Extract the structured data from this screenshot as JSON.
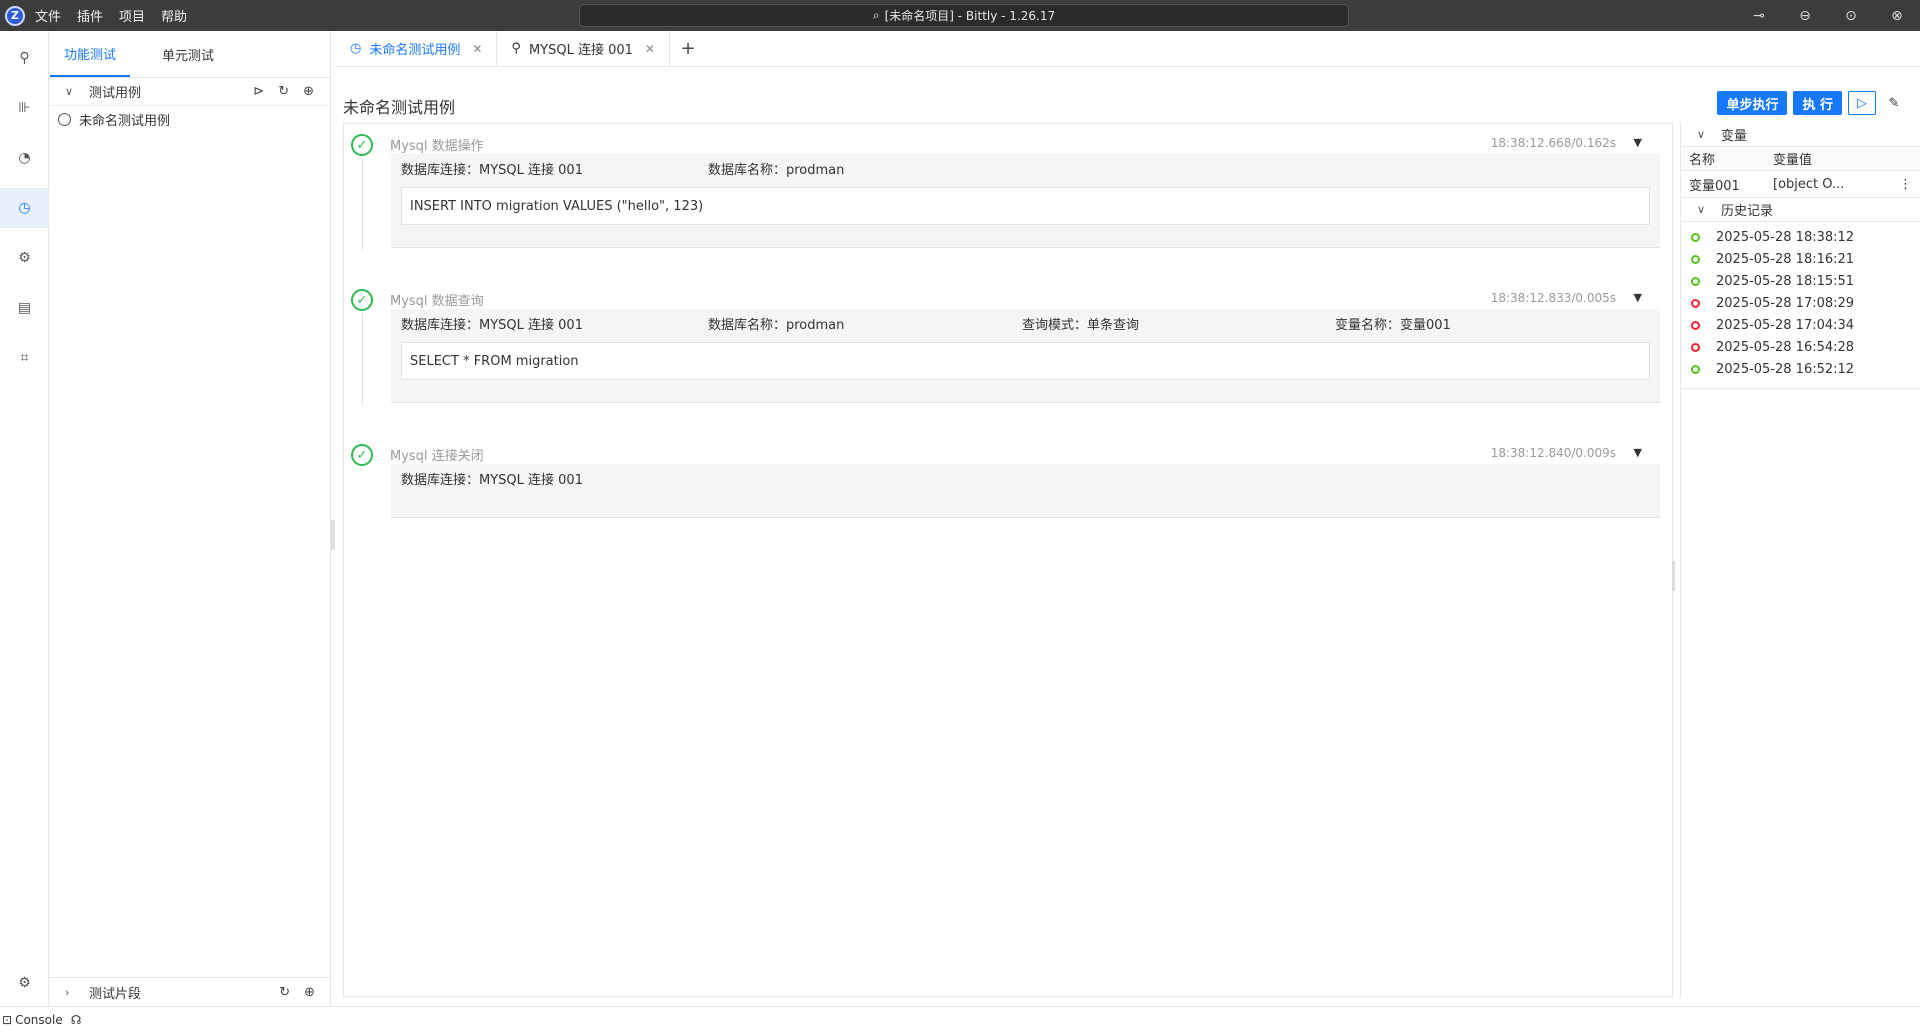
{
  "titlebar": {
    "logo": "Z",
    "menu": [
      "文件",
      "插件",
      "项目",
      "帮助"
    ],
    "search_text": "[未命名项目] - Bittly - 1.26.17",
    "icons": [
      "pin-icon",
      "minimize-icon",
      "maximize-icon",
      "close-icon"
    ]
  },
  "activitybar": {
    "items": [
      "plug-icon",
      "ruler-icon",
      "gauge-icon",
      "test-icon",
      "tools-icon",
      "panel-icon",
      "scan-icon"
    ],
    "settings": "gear-icon"
  },
  "sidepanel": {
    "tabs": [
      "功能测试",
      "单元测试"
    ],
    "tree_title": "测试用例",
    "tree_items": [
      "未命名测试用例"
    ],
    "bottom_title": "测试片段"
  },
  "editor": {
    "tabs": [
      {
        "label": "未命名测试用例",
        "active": true
      },
      {
        "label": "MYSQL 连接 001",
        "active": false
      }
    ],
    "case_title": "未命名测试用例",
    "toolbar": {
      "step_run": "单步执行",
      "run": "执 行"
    }
  },
  "steps": [
    {
      "name": "Mysql 数据操作",
      "time": "18:38:12.668/0.162s",
      "fields": [
        "数据库连接：MYSQL 连接 001",
        "数据库名称：prodman"
      ],
      "sql": "INSERT INTO migration VALUES (\"hello\", 123)"
    },
    {
      "name": "Mysql 数据查询",
      "time": "18:38:12.833/0.005s",
      "fields": [
        "数据库连接：MYSQL 连接 001",
        "数据库名称：prodman",
        "查询模式：单条查询",
        "变量名称：变量001"
      ],
      "sql": "SELECT * FROM migration"
    },
    {
      "name": "Mysql 连接关闭",
      "time": "18:38:12.840/0.009s",
      "fields": [
        "数据库连接：MYSQL 连接 001"
      ]
    }
  ],
  "variables": {
    "section": "变量",
    "head": [
      "名称",
      "变量值"
    ],
    "rows": [
      {
        "name": "变量001",
        "value": "[object O..."
      }
    ]
  },
  "history": {
    "section": "历史记录",
    "items": [
      {
        "time": "2025-05-28 18:38:12",
        "status": "success"
      },
      {
        "time": "2025-05-28 18:16:21",
        "status": "success"
      },
      {
        "time": "2025-05-28 18:15:51",
        "status": "success"
      },
      {
        "time": "2025-05-28 17:08:29",
        "status": "fail"
      },
      {
        "time": "2025-05-28 17:04:34",
        "status": "fail"
      },
      {
        "time": "2025-05-28 16:54:28",
        "status": "fail"
      },
      {
        "time": "2025-05-28 16:52:12",
        "status": "success"
      }
    ],
    "colors": {
      "success": "#52c41a",
      "fail": "#f5222d"
    }
  },
  "statusbar": {
    "console": "Console"
  }
}
